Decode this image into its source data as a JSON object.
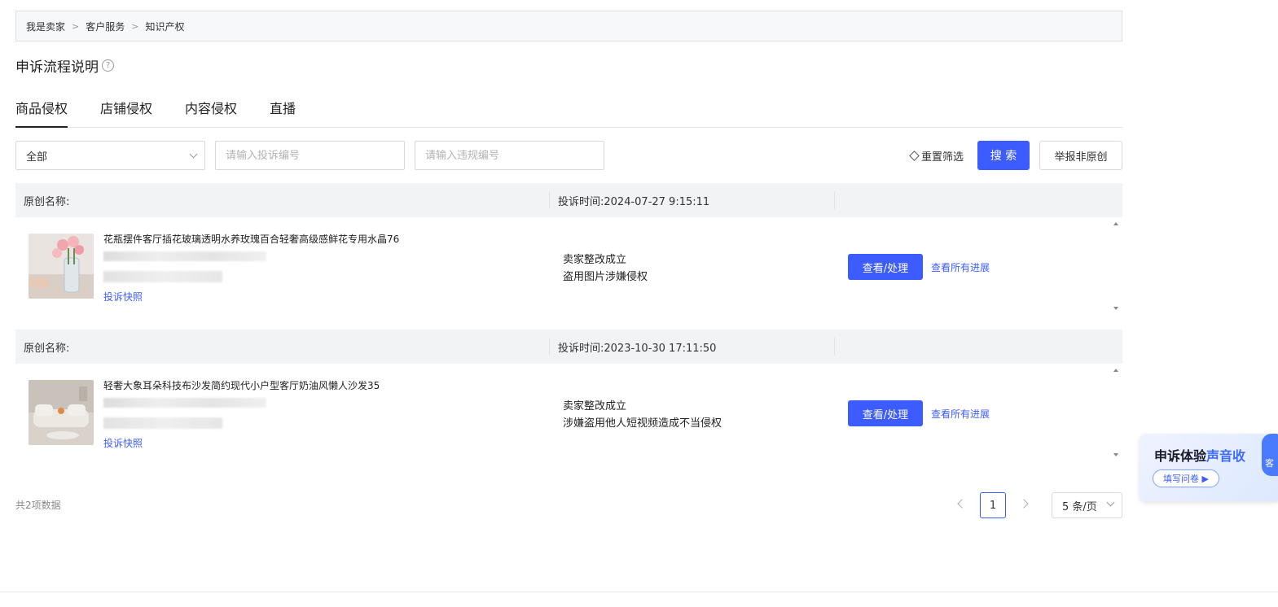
{
  "breadcrumb": [
    "我是卖家",
    "客户服务",
    "知识产权"
  ],
  "breadcrumb_sep": ">",
  "page_title": "申诉流程说明",
  "help_icon_glyph": "?",
  "tabs": [
    "商品侵权",
    "店铺侵权",
    "内容侵权",
    "直播"
  ],
  "filters": {
    "select_value": "全部",
    "complaint_placeholder": "请输入投诉编号",
    "violation_placeholder": "请输入违规编号",
    "reset_label": "重置筛选",
    "search_label": "搜 索",
    "report_label": "举报非原创"
  },
  "records": [
    {
      "original_label": "原创名称:",
      "complaint_time": "投诉时间:2024-07-27 9:15:11",
      "product_name": "花瓶摆件客厅插花玻璃透明水养玫瑰百合轻奢高级感鲜花专用水晶76",
      "snapshot_label": "投诉快照",
      "status_line1": "卖家整改成立",
      "status_line2": "盗用图片涉嫌侵权",
      "view_label": "查看/处理",
      "progress_label": "查看所有进展"
    },
    {
      "original_label": "原创名称:",
      "complaint_time": "投诉时间:2023-10-30 17:11:50",
      "product_name": "轻奢大象耳朵科技布沙发简约现代小户型客厅奶油风懒人沙发35",
      "snapshot_label": "投诉快照",
      "status_line1": "卖家整改成立",
      "status_line2": "涉嫌盗用他人短视频造成不当侵权",
      "view_label": "查看/处理",
      "progress_label": "查看所有进展"
    }
  ],
  "pagination": {
    "total_text": "共2项数据",
    "current_page": "1",
    "page_size": "5 条/页"
  },
  "float_card": {
    "title_prefix": "申诉体验",
    "title_highlight": "声音收",
    "button_label": "填写问卷 ▶",
    "avatar_text": "客"
  },
  "colors": {
    "primary": "#3d5cff",
    "header_bg": "#f2f3f5"
  }
}
